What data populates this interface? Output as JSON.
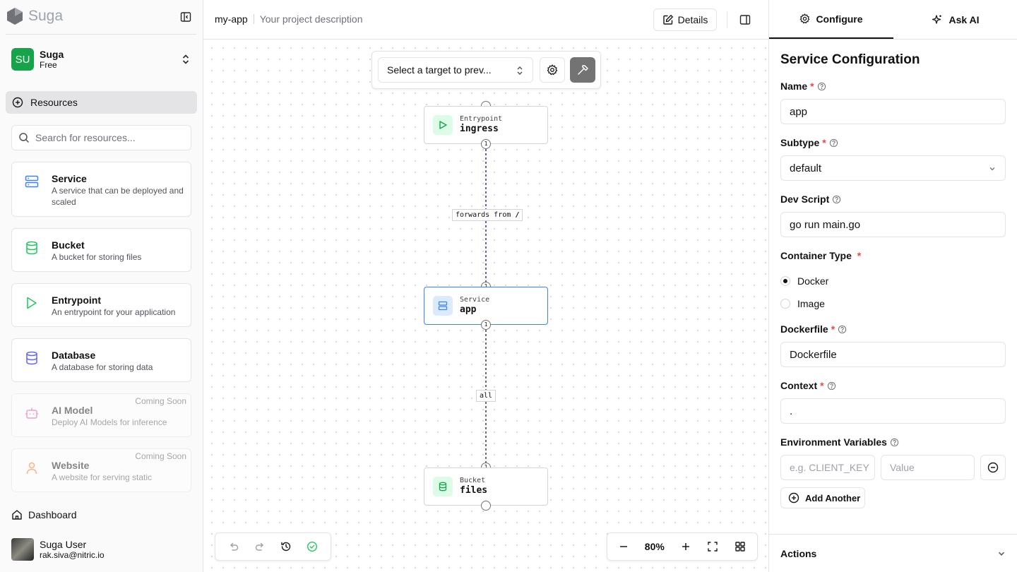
{
  "sidebar": {
    "logo_text": "Suga",
    "org": {
      "initials": "SU",
      "name": "Suga",
      "plan": "Free"
    },
    "resources_label": "Resources",
    "search_placeholder": "Search for resources...",
    "resources": [
      {
        "name": "Service",
        "desc": "A service that can be deployed and scaled",
        "icon": "server-icon",
        "color": "#3b82f6",
        "coming_soon": ""
      },
      {
        "name": "Bucket",
        "desc": "A bucket for storing files",
        "icon": "database-icon",
        "color": "#22c55e",
        "coming_soon": ""
      },
      {
        "name": "Entrypoint",
        "desc": "An entrypoint for your application",
        "icon": "play-icon",
        "color": "#22c55e",
        "coming_soon": ""
      },
      {
        "name": "Database",
        "desc": "A database for storing data",
        "icon": "database-icon",
        "color": "#6366f1",
        "coming_soon": ""
      },
      {
        "name": "AI Model",
        "desc": "Deploy AI Models for inference",
        "icon": "bot-icon",
        "color": "#ec4899",
        "coming_soon": "Coming Soon"
      },
      {
        "name": "Website",
        "desc": "A website for serving static",
        "icon": "user-icon",
        "color": "#f97316",
        "coming_soon": "Coming Soon"
      }
    ],
    "dashboard_label": "Dashboard",
    "user": {
      "name": "Suga User",
      "email": "rak.siva@nitric.io"
    }
  },
  "topbar": {
    "project_name": "my-app",
    "project_desc": "Your project description",
    "details_label": "Details"
  },
  "canvas": {
    "target_placeholder": "Select a target to prev...",
    "nodes": [
      {
        "type": "Entrypoint",
        "name": "ingress"
      },
      {
        "type": "Service",
        "name": "app"
      },
      {
        "type": "Bucket",
        "name": "files"
      }
    ],
    "edges": [
      {
        "label_prefix": "forwards from",
        "label_path": "/",
        "from_badge": "1",
        "to_badge": "1"
      },
      {
        "label": "all",
        "from_badge": "1",
        "to_badge": "1"
      }
    ],
    "zoom": "80%"
  },
  "right": {
    "tabs": [
      "Configure",
      "Ask AI"
    ],
    "title": "Service Configuration",
    "fields": {
      "name": {
        "label": "Name",
        "value": "app"
      },
      "subtype": {
        "label": "Subtype",
        "value": "default"
      },
      "dev_script": {
        "label": "Dev Script",
        "value": "go run main.go"
      },
      "container_type": {
        "label": "Container Type",
        "options": [
          "Docker",
          "Image"
        ],
        "selected": "Docker"
      },
      "dockerfile": {
        "label": "Dockerfile",
        "value": "Dockerfile"
      },
      "context": {
        "label": "Context",
        "value": "."
      },
      "env": {
        "label": "Environment Variables",
        "key_placeholder": "e.g. CLIENT_KEY",
        "value_placeholder": "Value",
        "add_label": "Add Another"
      }
    },
    "actions_label": "Actions"
  }
}
